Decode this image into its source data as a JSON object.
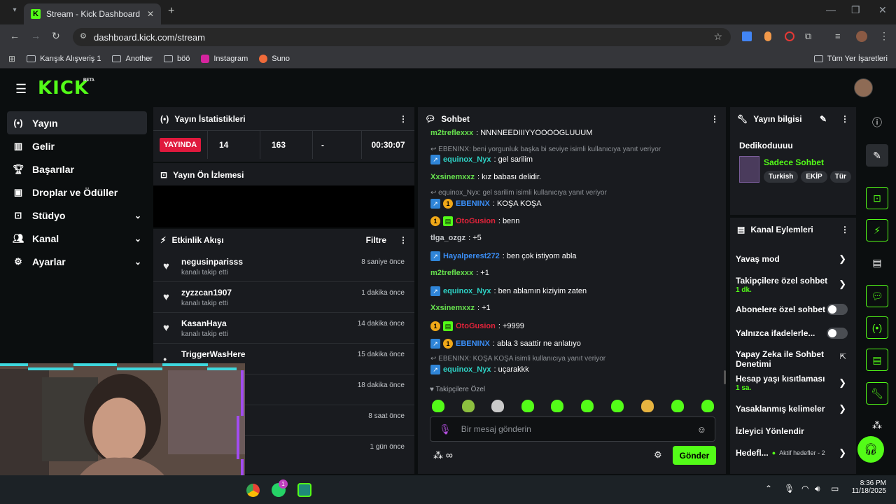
{
  "browser": {
    "tab_title": "Stream - Kick Dashboard",
    "url": "dashboard.kick.com/stream",
    "bookmarks": [
      "Karışık Alışveriş 1",
      "Another",
      "böö",
      "Instagram",
      "Suno"
    ],
    "bookmarks_right": "Tüm Yer İşaretleri"
  },
  "app": {
    "logo": "KICK",
    "beta": "BETA",
    "nav": [
      {
        "label": "Yayın",
        "icon": "broadcast-icon"
      },
      {
        "label": "Gelir",
        "icon": "chart-icon"
      },
      {
        "label": "Başarılar",
        "icon": "trophy-icon"
      },
      {
        "label": "Droplar ve Ödüller",
        "icon": "gift-icon"
      },
      {
        "label": "Stüdyo",
        "icon": "studio-icon"
      },
      {
        "label": "Kanal",
        "icon": "users-icon"
      },
      {
        "label": "Ayarlar",
        "icon": "gear-icon"
      }
    ]
  },
  "stats": {
    "title": "Yayın İstatistikleri",
    "live": "YAYINDA",
    "viewers": "14",
    "followers": "163",
    "dash": "-",
    "duration": "00:30:07"
  },
  "preview": {
    "title": "Yayın Ön İzlemesi"
  },
  "activity": {
    "title": "Etkinlik Akışı",
    "filter": "Filtre",
    "items": [
      {
        "name": "negusinparisss",
        "sub": "kanalı takip etti",
        "time": "8 saniye önce"
      },
      {
        "name": "zyzzcan1907",
        "sub": "kanalı takip etti",
        "time": "1 dakika önce"
      },
      {
        "name": "KasanHaya",
        "sub": "kanalı takip etti",
        "time": "14 dakika önce"
      },
      {
        "name": "TriggerWasHere",
        "sub": "",
        "time": "15 dakika önce"
      },
      {
        "name": "",
        "sub": "",
        "time": "18 dakika önce"
      },
      {
        "name": "",
        "sub": "",
        "time": "8 saat önce"
      },
      {
        "name": "",
        "sub": "",
        "time": "1 gün önce"
      }
    ]
  },
  "chat": {
    "title": "Sohbet",
    "messages": {
      "m1_user": "m2treflexxx",
      "m1_text": ": NNNNEEDIIIYYOOOOGLUUUM",
      "r1": "EBENINX: beni yorgunluk başka bi seviye isimli kullanıcıya yanıt veriyor",
      "m2_user": "equinox_Nyx",
      "m2_text": ": gel sarilim",
      "m3_user": "Xxsinemxxz",
      "m3_text": ": kız babası delidir.",
      "r2": "equinox_Nyx: gel sarilim isimli kullanıcıya yanıt veriyor",
      "m4_user": "EBENINX",
      "m4_text": ": KOŞA KOŞA",
      "m5_user": "OtoGusion",
      "m5_text": ": benn",
      "m6_user": "tlga_ozgz",
      "m6_text": ": +5",
      "m7_user": "Hayalperest272",
      "m7_text": ": ben çok istiyom abla",
      "m8_user": "m2treflexxx",
      "m8_text": ": +1",
      "m9_user": "equinox_Nyx",
      "m9_text": ": ben ablamın kiziyim zaten",
      "m10_user": "Xxsinemxxz",
      "m10_text": ": +1",
      "m11_user": "OtoGusion",
      "m11_text": ": +9999",
      "m12_user": "EBENINX",
      "m12_text": ": abla 3 saattir ne anlatıyo",
      "r3": "EBENINX: KOŞA KOŞA isimli kullanıcıya yanıt veriyor",
      "m13_user": "equinox_Nyx",
      "m13_text": ": uçarakkk"
    },
    "followers_only": "Takipçilere Özel",
    "placeholder": "Bir mesaj gönderin",
    "send": "Gönder",
    "badge_one": "1"
  },
  "stream_info": {
    "title": "Yayın bilgisi",
    "stream_title": "Dedikoduuuu",
    "category": "Sadece Sohbet",
    "tags": [
      "Turkish",
      "EKİP",
      "Tür"
    ]
  },
  "channel_actions": {
    "title": "Kanal Eylemleri",
    "slow": "Yavaş mod",
    "followers_chat": "Takipçilere özel sohbet",
    "followers_chat_sub": "1 dk.",
    "subs_chat": "Abonelere özel sohbet",
    "emotes_only": "Yalnızca ifadelerle...",
    "ai_chat": "Yapay Zeka ile Sohbet Denetimi",
    "age": "Hesap yaşı kısıtlaması",
    "age_sub": "1 sa.",
    "banned": "Yasaklanmış kelimeler",
    "redirect": "İzleyici Yönlendir",
    "goals": "Hedefl...",
    "goals_sub": "Aktif hedefler - 2"
  },
  "taskbar": {
    "time": "8:36 PM",
    "date": "11/18/2025",
    "wa_badge": "1"
  }
}
